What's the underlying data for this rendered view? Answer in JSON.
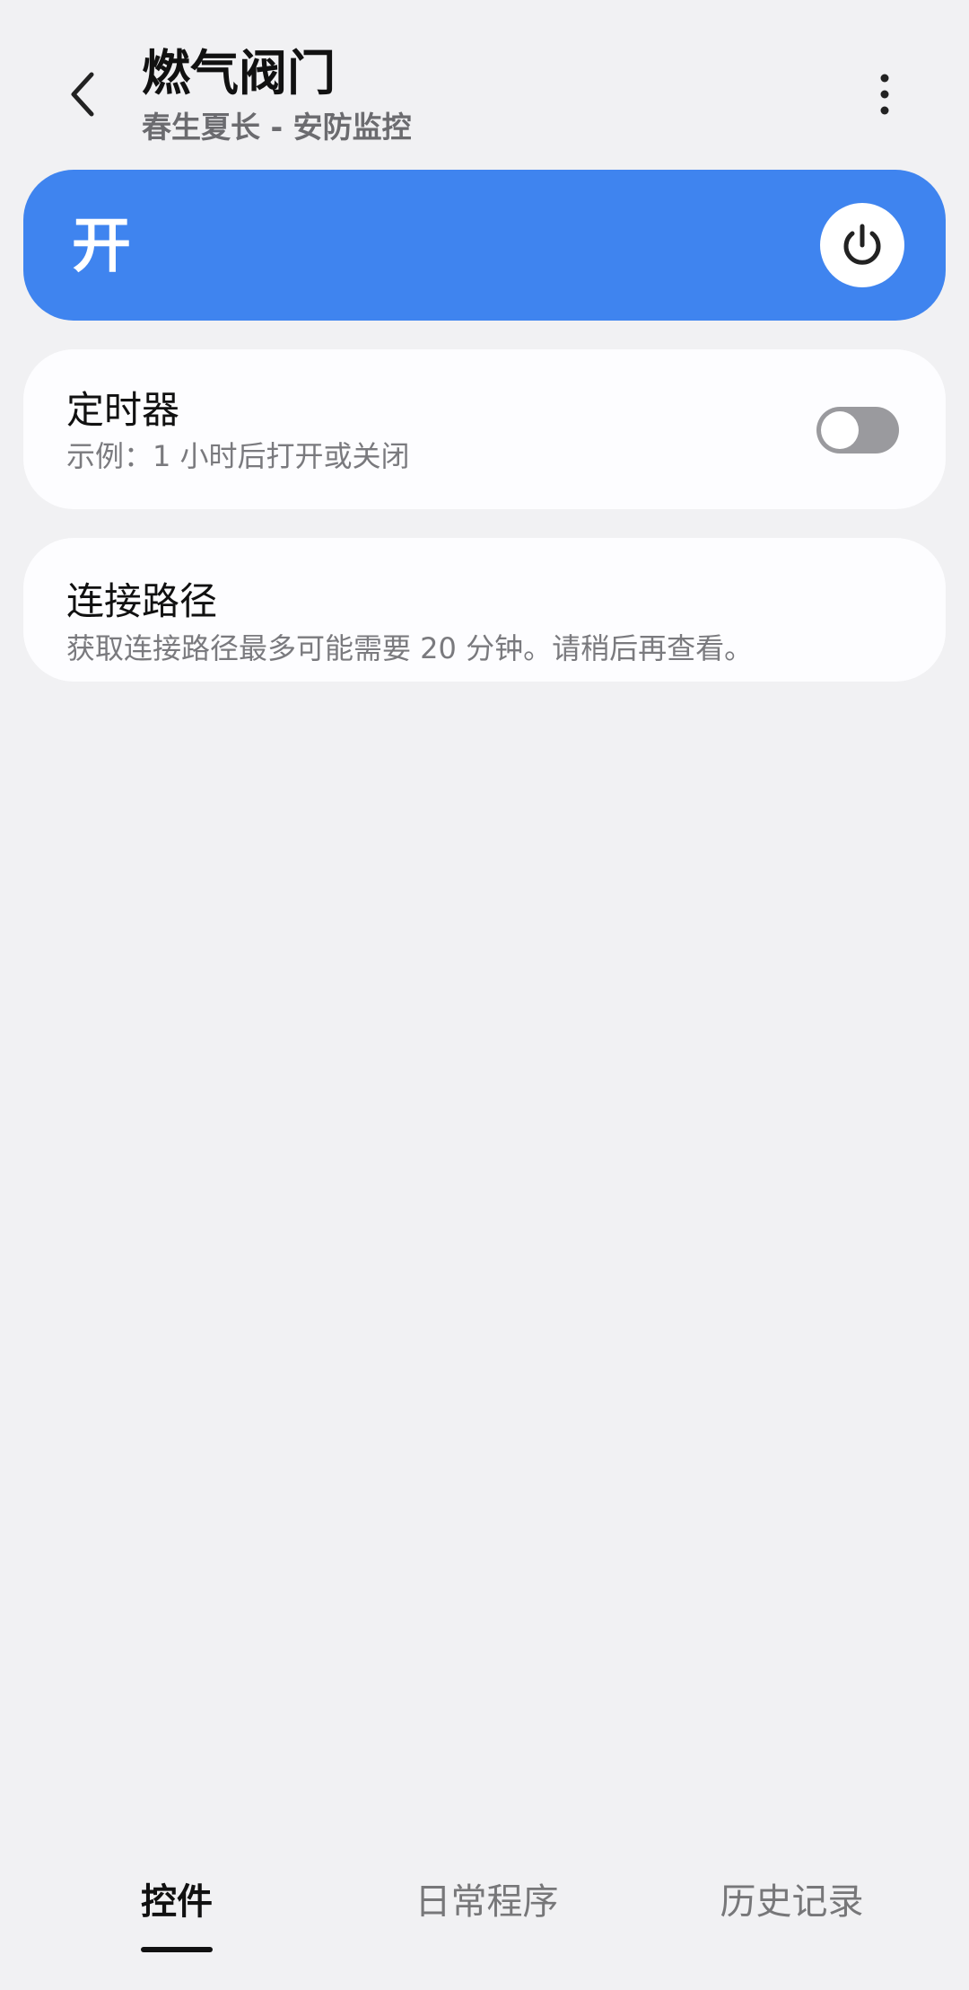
{
  "header": {
    "back_icon": "chevron-left-icon",
    "title": "燃气阀门",
    "subtitle": "春生夏长 - 安防监控",
    "more_icon": "more-vertical-icon"
  },
  "power": {
    "state_label": "开",
    "icon": "power-icon",
    "is_on": true,
    "accent_color": "#3f84ef"
  },
  "timer": {
    "title": "定时器",
    "description": "示例：1 小时后打开或关闭",
    "enabled": false
  },
  "connection_path": {
    "title": "连接路径",
    "description": "获取连接路径最多可能需要 20 分钟。请稍后再查看。"
  },
  "bottom_nav": {
    "tabs": [
      {
        "label": "控件",
        "active": true
      },
      {
        "label": "日常程序",
        "active": false
      },
      {
        "label": "历史记录",
        "active": false
      }
    ]
  }
}
